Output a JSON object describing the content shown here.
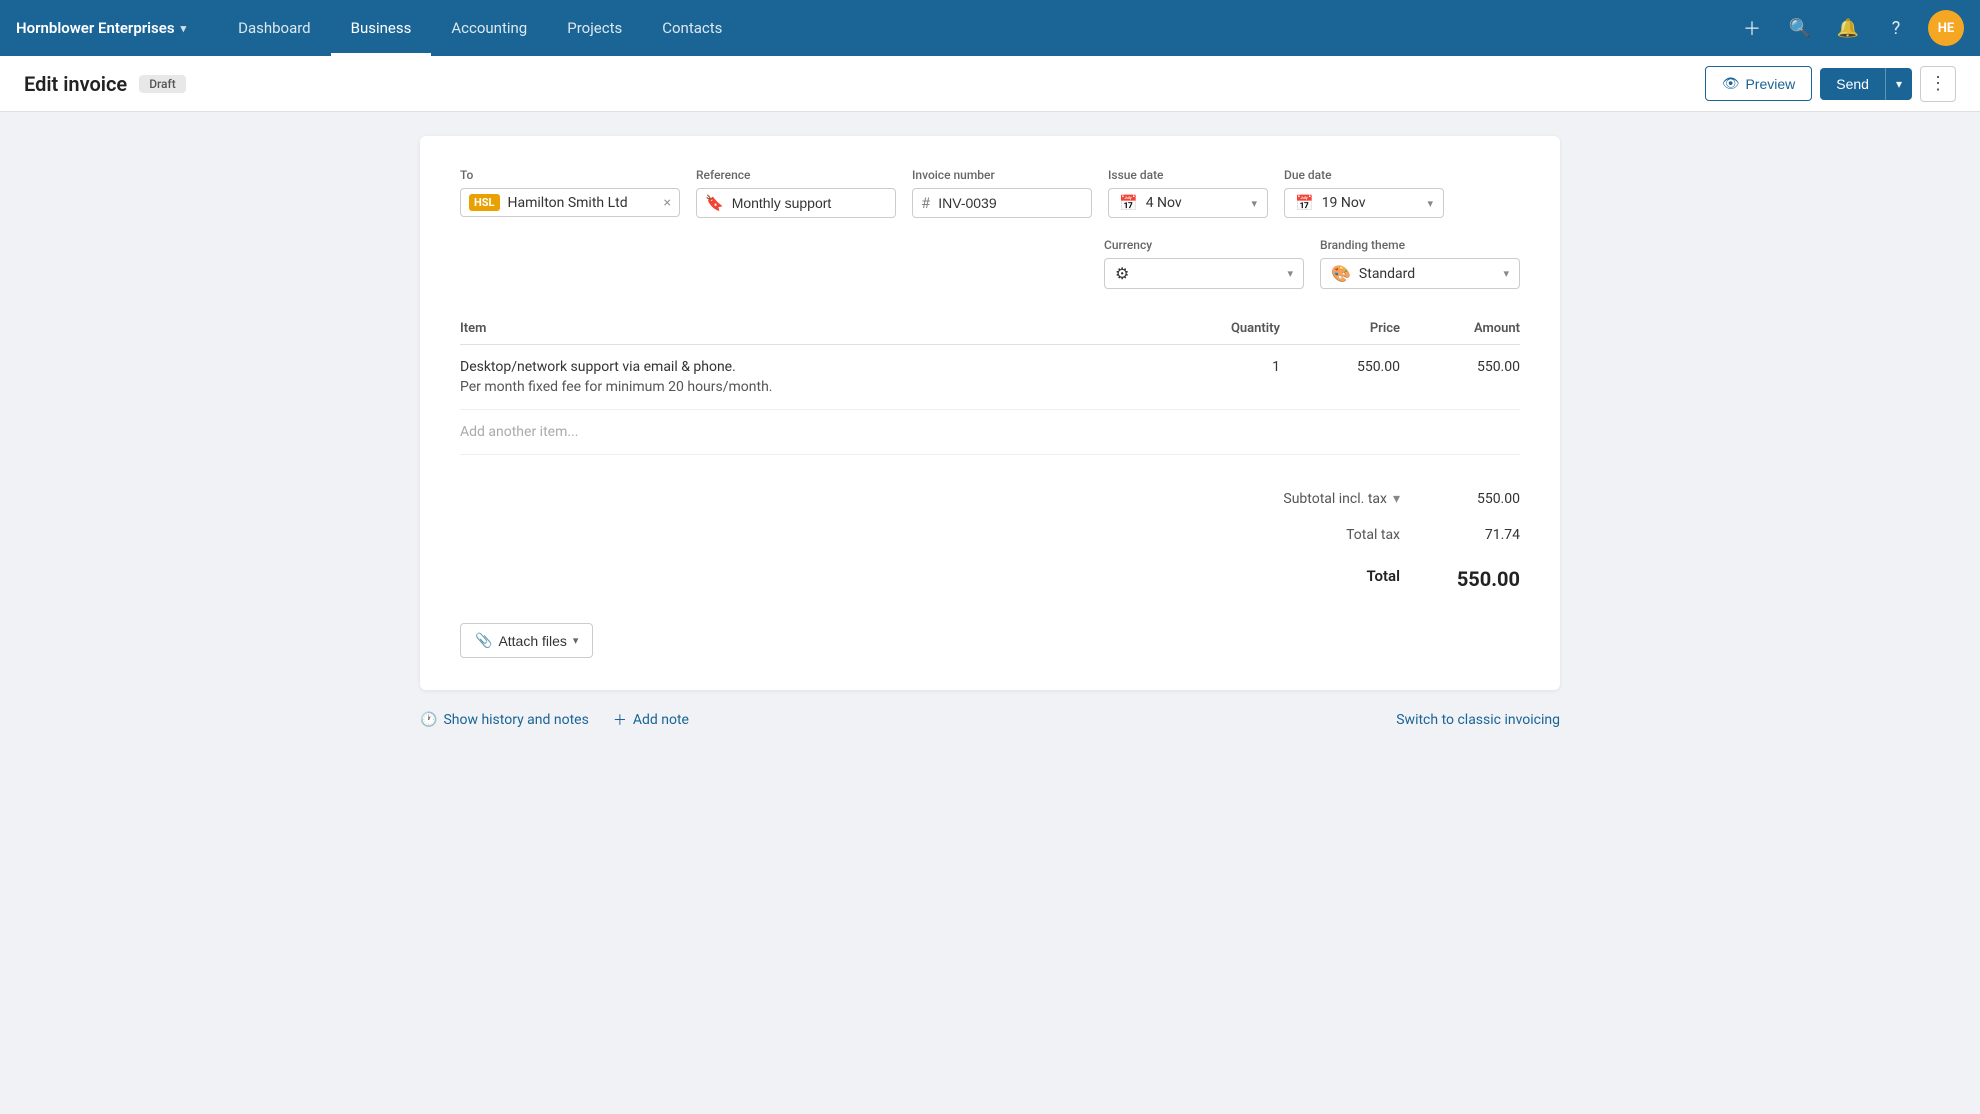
{
  "brand": {
    "name": "Hornblower Enterprises",
    "chevron": "▾",
    "initials": "HE"
  },
  "nav": {
    "links": [
      {
        "label": "Dashboard",
        "active": false
      },
      {
        "label": "Business",
        "active": true
      },
      {
        "label": "Accounting",
        "active": false
      },
      {
        "label": "Projects",
        "active": false
      },
      {
        "label": "Contacts",
        "active": false
      }
    ]
  },
  "header": {
    "title": "Edit invoice",
    "badge": "Draft",
    "preview_label": "Preview",
    "send_label": "Send",
    "more_icon": "⋮"
  },
  "form": {
    "to_label": "To",
    "to_badge": "HSL",
    "to_value": "Hamilton Smith Ltd",
    "ref_label": "Reference",
    "ref_icon": "🔖",
    "ref_value": "Monthly support",
    "inv_label": "Invoice number",
    "inv_value": "INV-0039",
    "issue_label": "Issue date",
    "issue_value": "4 Nov",
    "due_label": "Due date",
    "due_value": "19 Nov",
    "currency_label": "Currency",
    "currency_icon": "⚙",
    "branding_label": "Branding theme",
    "branding_icon": "🎨",
    "branding_value": "Standard"
  },
  "line_items": {
    "col_item": "Item",
    "col_qty": "Quantity",
    "col_price": "Price",
    "col_amount": "Amount",
    "rows": [
      {
        "desc": "Desktop/network support via email & phone.",
        "desc_sub": "Per month fixed fee for minimum 20 hours/month.",
        "qty": "1",
        "price": "550.00",
        "amount": "550.00"
      }
    ],
    "add_placeholder": "Add another item..."
  },
  "totals": {
    "subtotal_label": "Subtotal incl. tax",
    "subtotal_value": "550.00",
    "tax_label": "Total tax",
    "tax_value": "71.74",
    "total_label": "Total",
    "total_value": "550.00"
  },
  "footer": {
    "attach_label": "Attach files"
  },
  "bottom_bar": {
    "history_label": "Show history and notes",
    "add_note_label": "Add note",
    "classic_label": "Switch to classic invoicing"
  }
}
